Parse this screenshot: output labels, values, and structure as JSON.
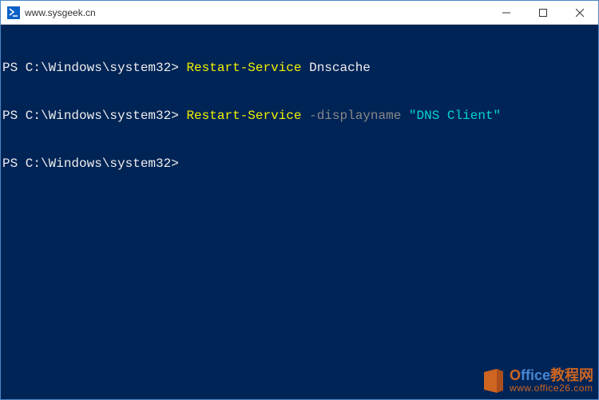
{
  "window": {
    "title": "www.sysgeek.cn"
  },
  "terminal": {
    "lines": [
      {
        "prompt": "PS C:\\Windows\\system32>",
        "cmd": "Restart-Service",
        "arg_plain": "Dnscache"
      },
      {
        "prompt": "PS C:\\Windows\\system32>",
        "cmd": "Restart-Service",
        "param": "-displayname",
        "arg_string": "\"DNS Client\""
      },
      {
        "prompt": "PS C:\\Windows\\system32>"
      }
    ]
  },
  "watermark": {
    "brand_prefix": "O",
    "brand_rest": "ffice",
    "brand_suffix": "教程网",
    "url": "www.office26.com"
  }
}
